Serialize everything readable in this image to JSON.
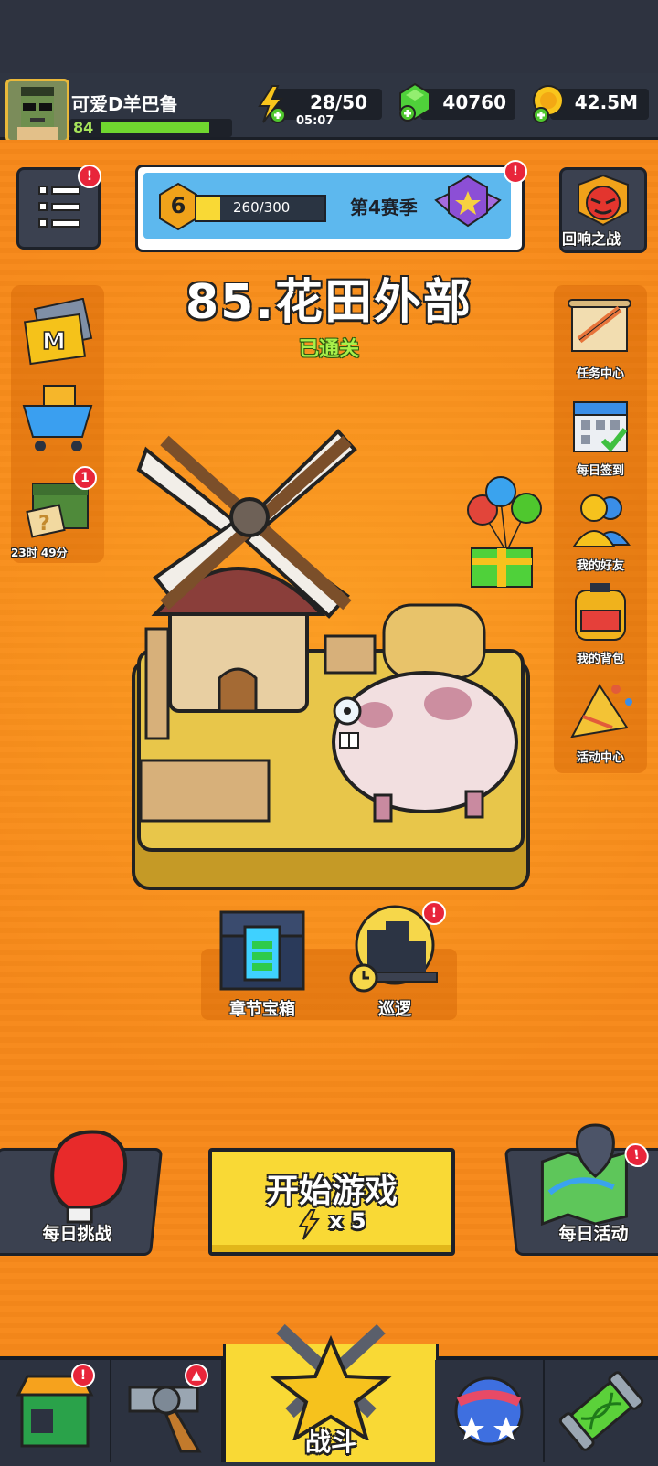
{
  "player": {
    "name": "可爱D羊巴鲁",
    "level": "84",
    "xp_fraction": 0.85
  },
  "resources": {
    "energy": "28/50",
    "energy_timer": "05:07",
    "gems": "40760",
    "coins": "42.5M"
  },
  "season": {
    "level": "6",
    "progress": "260/300",
    "progress_fraction": 0.867,
    "label": "第4赛季"
  },
  "echo_battle": {
    "label": "回响之战"
  },
  "stage": {
    "title": "85.花田外部",
    "status": "已通关"
  },
  "left_panel": {
    "timer": "23时 49分",
    "badge": "1"
  },
  "right_panel": {
    "items": [
      {
        "label": "任务中心"
      },
      {
        "label": "每日签到"
      },
      {
        "label": "我的好友"
      },
      {
        "label": "我的背包"
      },
      {
        "label": "活动中心"
      }
    ]
  },
  "chapter": {
    "chest_label": "章节宝箱",
    "patrol_label": "巡逻"
  },
  "bottom_actions": {
    "daily_challenge": "每日挑战",
    "start_game": "开始游戏",
    "energy_cost": "x 5",
    "daily_event": "每日活动"
  },
  "nav": {
    "battle": "战斗"
  },
  "colors": {
    "accent": "#f7891a",
    "button_yellow": "#f9d935",
    "badge_red": "#e8253a",
    "dark_panel": "#2f3542"
  }
}
